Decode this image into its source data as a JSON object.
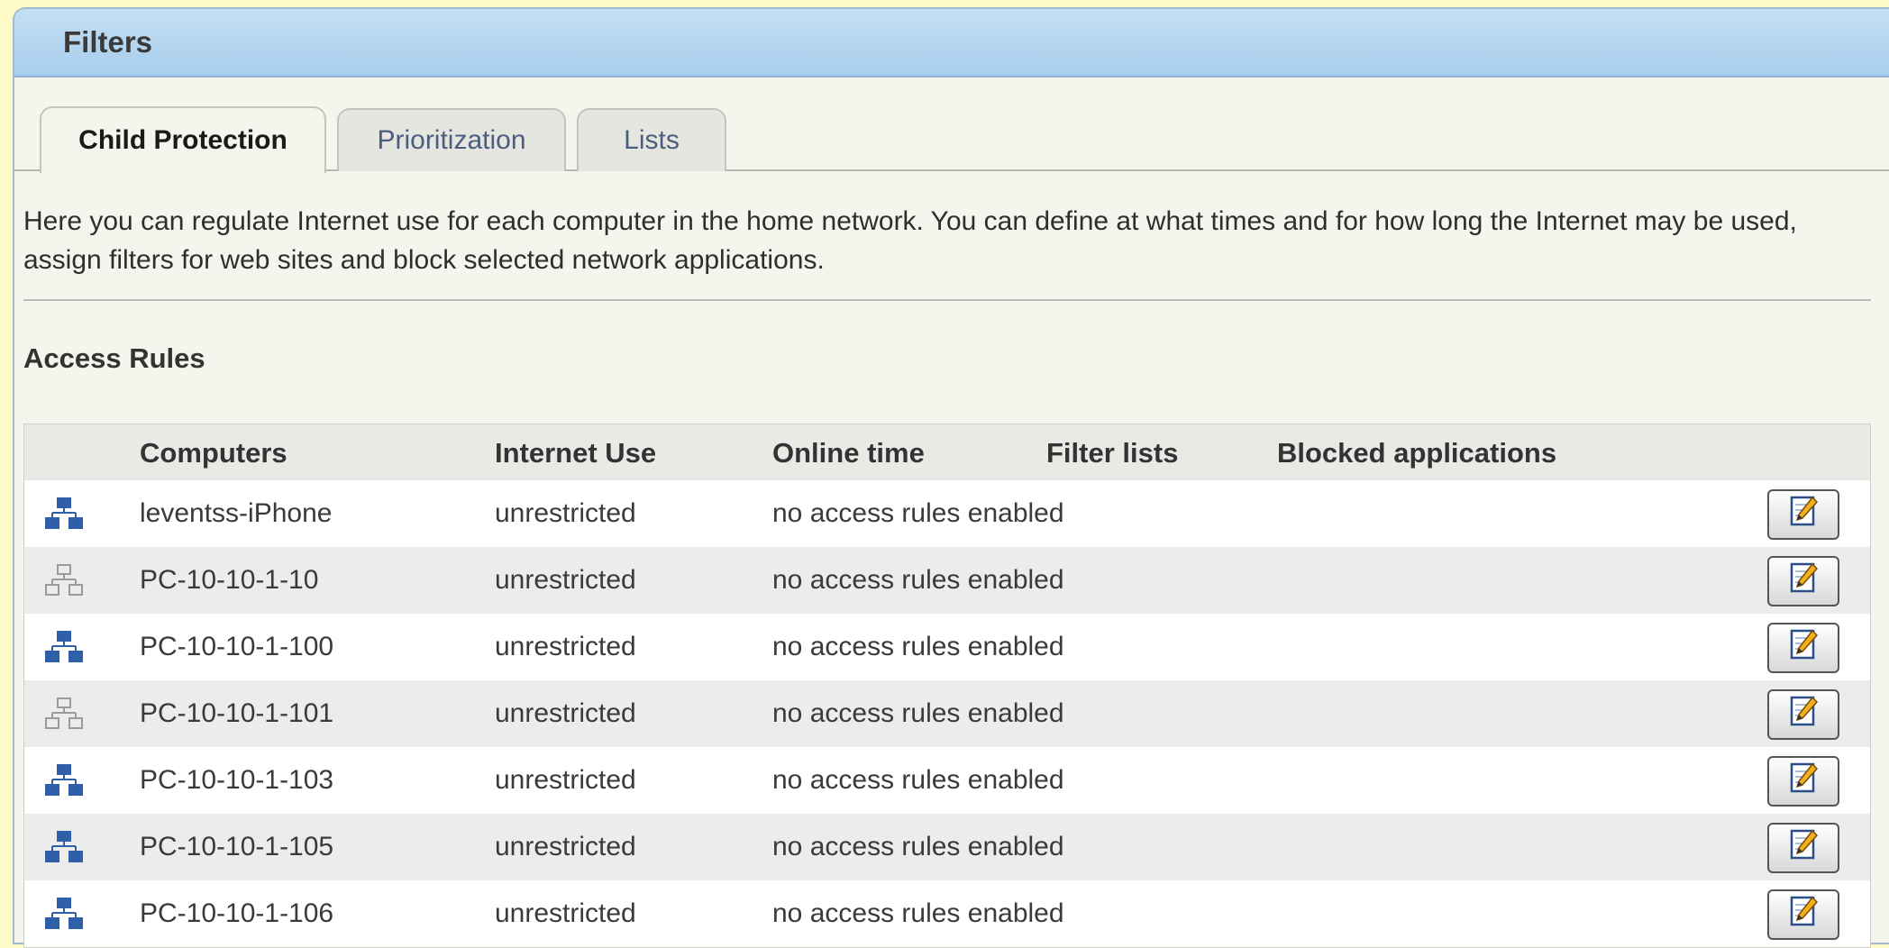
{
  "panel": {
    "title": "Filters"
  },
  "tabs": [
    {
      "label": "Child Protection",
      "active": true
    },
    {
      "label": "Prioritization",
      "active": false
    },
    {
      "label": "Lists",
      "active": false
    }
  ],
  "intro": "Here you can regulate Internet use for each computer in the home network. You can define at what times and for how long the Internet may be used, assign filters for web sites and block selected network applications.",
  "access_rules": {
    "title": "Access Rules",
    "columns": [
      "Computers",
      "Internet Use",
      "Online time",
      "Filter lists",
      "Blocked applications"
    ],
    "rows": [
      {
        "computer": "leventss-iPhone",
        "internet_use": "unrestricted",
        "online_time": "no access rules enabled",
        "filter_lists": "",
        "blocked_applications": "",
        "status": "active",
        "edit_icon": "edit-icon"
      },
      {
        "computer": "PC-10-10-1-10",
        "internet_use": "unrestricted",
        "online_time": "no access rules enabled",
        "filter_lists": "",
        "blocked_applications": "",
        "status": "inactive",
        "edit_icon": "edit-icon"
      },
      {
        "computer": "PC-10-10-1-100",
        "internet_use": "unrestricted",
        "online_time": "no access rules enabled",
        "filter_lists": "",
        "blocked_applications": "",
        "status": "active",
        "edit_icon": "edit-icon"
      },
      {
        "computer": "PC-10-10-1-101",
        "internet_use": "unrestricted",
        "online_time": "no access rules enabled",
        "filter_lists": "",
        "blocked_applications": "",
        "status": "inactive",
        "edit_icon": "edit-icon"
      },
      {
        "computer": "PC-10-10-1-103",
        "internet_use": "unrestricted",
        "online_time": "no access rules enabled",
        "filter_lists": "",
        "blocked_applications": "",
        "status": "active",
        "edit_icon": "edit-icon"
      },
      {
        "computer": "PC-10-10-1-105",
        "internet_use": "unrestricted",
        "online_time": "no access rules enabled",
        "filter_lists": "",
        "blocked_applications": "",
        "status": "active",
        "edit_icon": "edit-icon"
      },
      {
        "computer": "PC-10-10-1-106",
        "internet_use": "unrestricted",
        "online_time": "no access rules enabled",
        "filter_lists": "",
        "blocked_applications": "",
        "status": "active",
        "edit_icon": "edit-icon"
      }
    ]
  },
  "colors": {
    "header_bg": "#b5d6ef",
    "network_active": "#2f5fa8",
    "network_inactive": "#9a9a9a",
    "page_bg": "#fffbc8"
  }
}
